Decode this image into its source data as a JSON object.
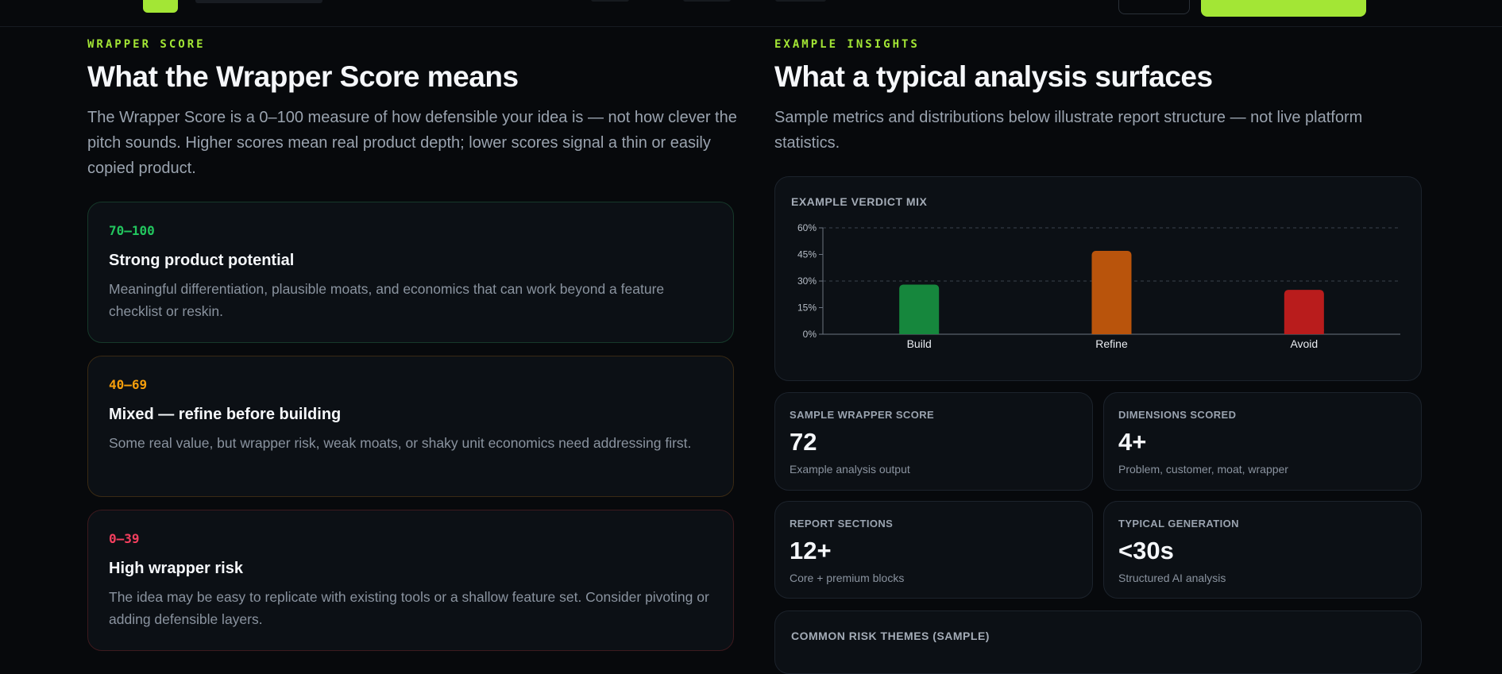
{
  "left": {
    "eyebrow": "WRAPPER SCORE",
    "title": "What the Wrapper Score means",
    "lead": "The Wrapper Score is a 0–100 measure of how defensible your idea is — not how clever the pitch sounds. Higher scores mean real product depth; lower scores signal a thin or easily copied product.",
    "cards": [
      {
        "range": "70–100",
        "title": "Strong product potential",
        "desc": "Meaningful differentiation, plausible moats, and economics that can work beyond a feature checklist or reskin."
      },
      {
        "range": "40–69",
        "title": "Mixed — refine before building",
        "desc": "Some real value, but wrapper risk, weak moats, or shaky unit economics need addressing first."
      },
      {
        "range": "0–39",
        "title": "High wrapper risk",
        "desc": "The idea may be easy to replicate with existing tools or a shallow feature set. Consider pivoting or adding defensible layers."
      }
    ]
  },
  "right": {
    "eyebrow": "EXAMPLE INSIGHTS",
    "title": "What a typical analysis surfaces",
    "lead": "Sample metrics and distributions below illustrate report structure — not live platform statistics.",
    "chart_title": "EXAMPLE VERDICT MIX",
    "stats": [
      {
        "label": "SAMPLE WRAPPER SCORE",
        "value": "72",
        "sub": "Example analysis output"
      },
      {
        "label": "DIMENSIONS SCORED",
        "value": "4+",
        "sub": "Problem, customer, moat, wrapper"
      },
      {
        "label": "REPORT SECTIONS",
        "value": "12+",
        "sub": "Core + premium blocks"
      },
      {
        "label": "TYPICAL GENERATION",
        "value": "<30s",
        "sub": "Structured AI analysis"
      }
    ],
    "risk_title": "COMMON RISK THEMES (SAMPLE)"
  },
  "chart_data": {
    "type": "bar",
    "categories": [
      "Build",
      "Refine",
      "Avoid"
    ],
    "values": [
      28,
      47,
      25
    ],
    "colors": [
      "#16873d",
      "#b9540c",
      "#b91c1c"
    ],
    "ylim": [
      0,
      60
    ],
    "yticks": [
      0,
      15,
      30,
      45,
      60
    ],
    "ytick_labels": [
      "0%",
      "15%",
      "30%",
      "45%",
      "60%"
    ],
    "grid": true
  }
}
